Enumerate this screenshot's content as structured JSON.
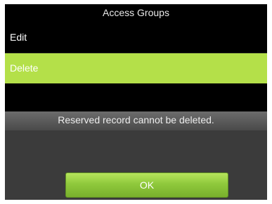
{
  "window": {
    "title": "Access Groups"
  },
  "menu": {
    "items": [
      {
        "label": "Edit"
      },
      {
        "label": "Delete",
        "selected": true
      }
    ]
  },
  "dialog": {
    "message": "Reserved record cannot be deleted.",
    "ok_label": "OK"
  },
  "colors": {
    "background": "#000000",
    "highlight": "#b4e049",
    "dialog_background": "#3b3b3b",
    "button_green": "#8fc93c"
  }
}
